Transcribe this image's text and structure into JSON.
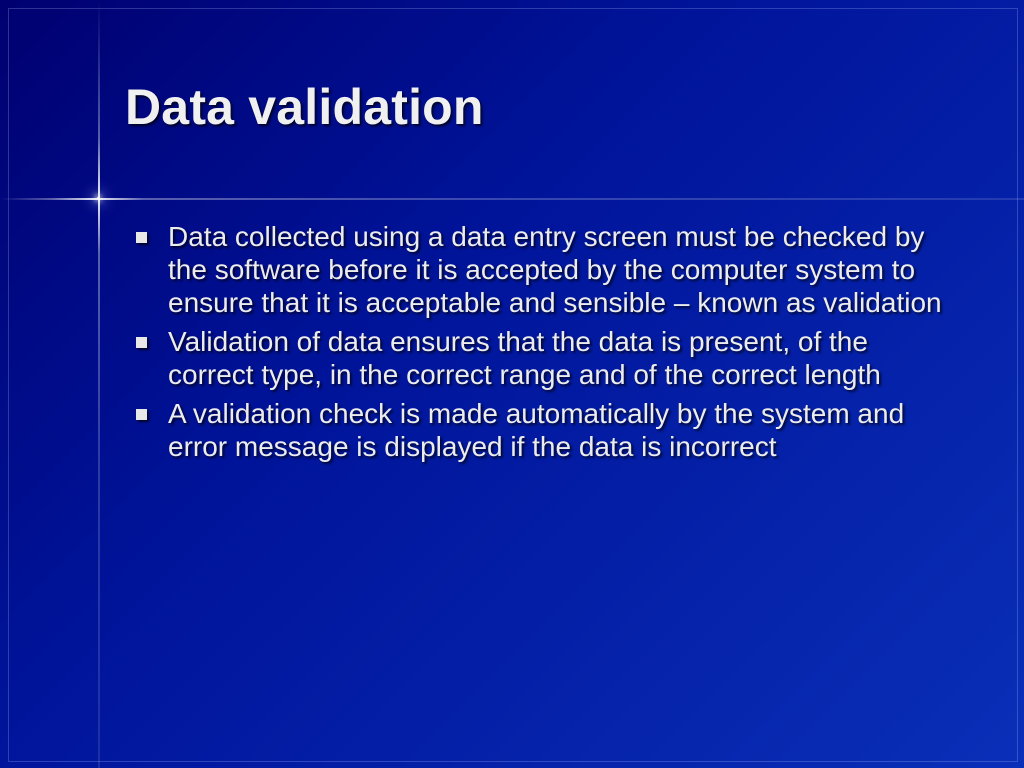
{
  "slide": {
    "title": "Data validation",
    "bullets": [
      "Data collected using a data entry screen must be checked by the software before it is accepted by the computer system to ensure that it is acceptable and sensible – known as validation",
      "Validation of data ensures that the data is present, of the correct type, in the correct range and of the correct length",
      "A validation check is made automatically by the system and error message is displayed if the data is incorrect"
    ]
  }
}
